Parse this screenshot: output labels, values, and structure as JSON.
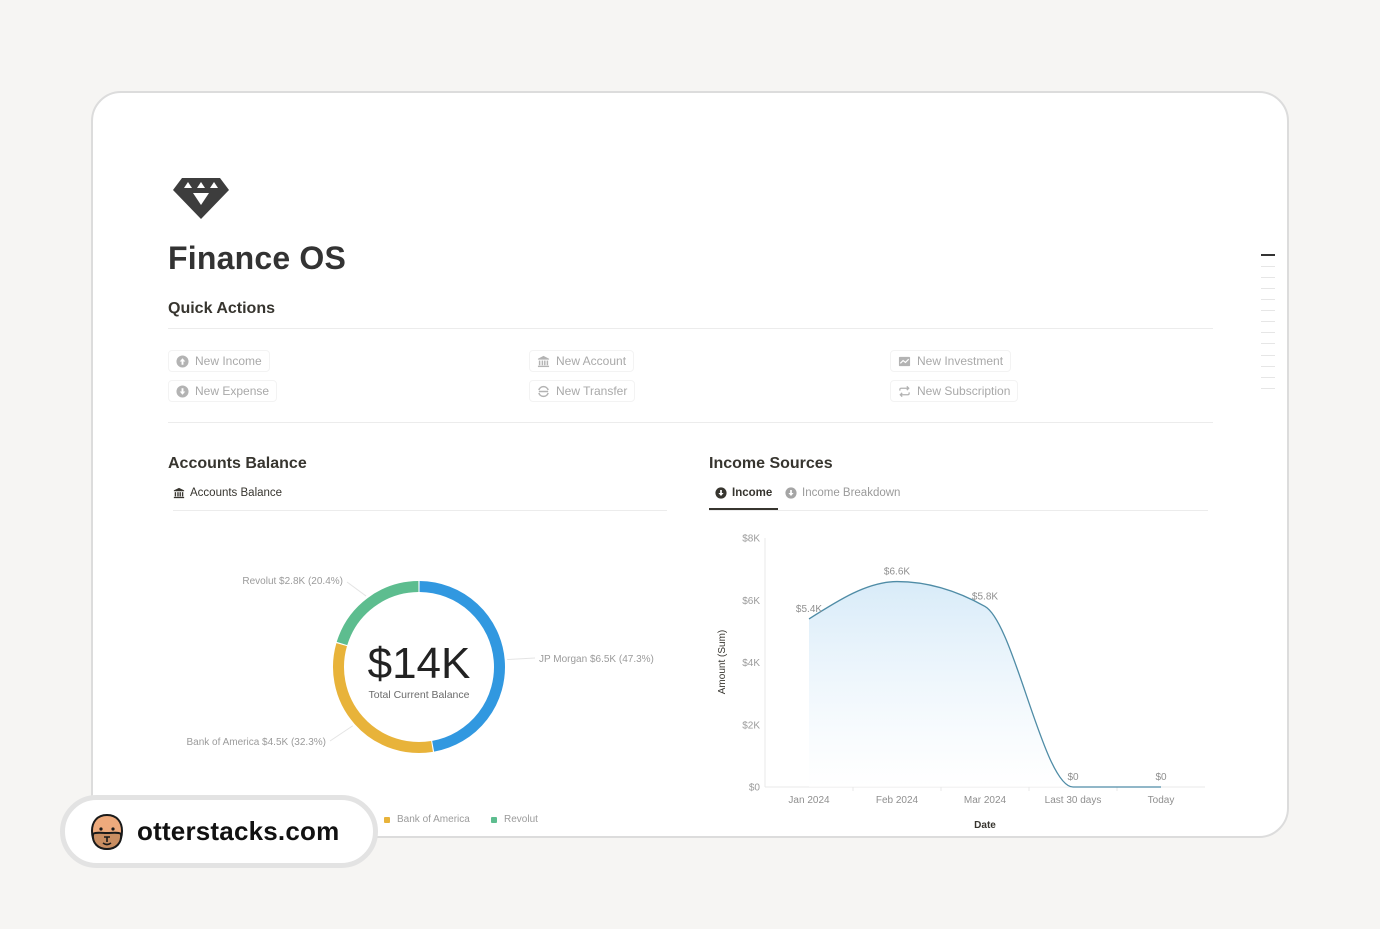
{
  "page": {
    "icon": "diamond-icon",
    "title": "Finance OS"
  },
  "quick_actions": {
    "heading": "Quick Actions",
    "items": [
      {
        "label": "New Income",
        "icon": "arrow-up-circle-icon"
      },
      {
        "label": "New Expense",
        "icon": "arrow-down-circle-icon"
      },
      {
        "label": "New Account",
        "icon": "bank-icon"
      },
      {
        "label": "New Transfer",
        "icon": "transfer-icon"
      },
      {
        "label": "New Investment",
        "icon": "chart-icon"
      },
      {
        "label": "New Subscription",
        "icon": "repeat-icon"
      }
    ]
  },
  "accounts": {
    "heading": "Accounts Balance",
    "tab": {
      "label": "Accounts Balance",
      "icon": "bank-icon"
    }
  },
  "income": {
    "heading": "Income Sources",
    "tabs": [
      {
        "label": "Income",
        "icon": "arrow-down-circle-icon",
        "active": true
      },
      {
        "label": "Income Breakdown",
        "icon": "arrow-down-circle-icon",
        "active": false
      }
    ]
  },
  "watermark": {
    "text": "otterstacks.com",
    "icon": "otter-face-icon"
  },
  "chart_data": [
    {
      "type": "pie",
      "title": "Accounts Balance",
      "center_value": "$14K",
      "center_label": "Total Current Balance",
      "slices": [
        {
          "name": "JP Morgan",
          "value": 6500,
          "percent": 47.3,
          "label": "JP Morgan $6.5K (47.3%)",
          "color": "#3198e0"
        },
        {
          "name": "Bank of America",
          "value": 4500,
          "percent": 32.3,
          "label": "Bank of America $4.5K (32.3%)",
          "color": "#e8b33a"
        },
        {
          "name": "Revolut",
          "value": 2800,
          "percent": 20.4,
          "label": "Revolut $2.8K (20.4%)",
          "color": "#5dbd8f"
        }
      ],
      "legend": [
        {
          "name": "Bank of America",
          "color": "#e8b33a"
        },
        {
          "name": "Revolut",
          "color": "#5dbd8f"
        }
      ],
      "legend_position": "bottom"
    },
    {
      "type": "area",
      "title": "Income Sources",
      "categories": [
        "Jan 2024",
        "Feb 2024",
        "Mar 2024",
        "Last 30 days",
        "Today"
      ],
      "series": [
        {
          "name": "Income",
          "values": [
            5400,
            6600,
            5800,
            0,
            0
          ],
          "labels": [
            "$5.4K",
            "$6.6K",
            "$5.8K",
            "$0",
            "$0"
          ],
          "color": "#4f8ca6",
          "fill": "#d6eaf8"
        }
      ],
      "xlabel": "Date",
      "ylabel": "Amount (Sum)",
      "ylim": [
        0,
        8000
      ],
      "yticks": [
        0,
        2000,
        4000,
        6000,
        8000
      ],
      "ytick_labels": [
        "$0",
        "$2K",
        "$4K",
        "$6K",
        "$8K"
      ],
      "grid": false
    }
  ]
}
